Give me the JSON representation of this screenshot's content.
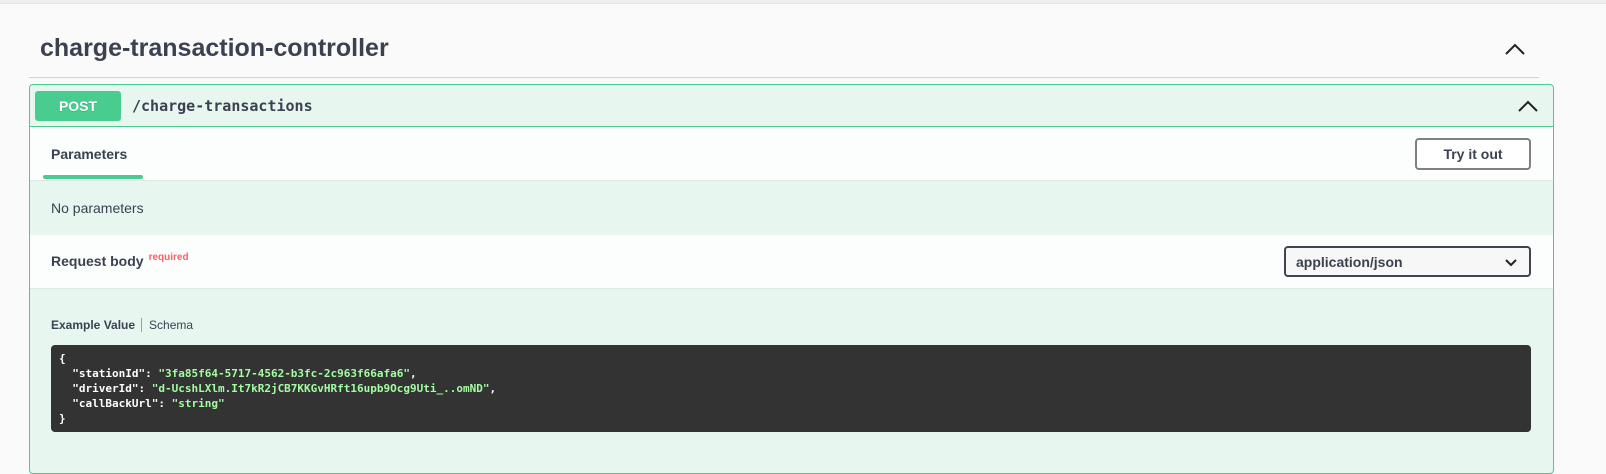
{
  "tag": {
    "title": "charge-transaction-controller",
    "toggle_icon": "chevron-up-icon"
  },
  "operation": {
    "method": "POST",
    "path": "/charge-transactions",
    "method_color": "#49cc90",
    "toggle_icon": "chevron-up-icon"
  },
  "parameters": {
    "tab_label": "Parameters",
    "try_button": "Try it out",
    "empty_text": "No parameters"
  },
  "request_body": {
    "title": "Request body",
    "required_label": "required",
    "content_type": "application/json"
  },
  "example": {
    "tab_example": "Example Value",
    "tab_schema": "Schema",
    "open_brace": "{",
    "close_brace": "}",
    "fields": [
      {
        "key": "\"stationId\"",
        "value": "\"3fa85f64-5717-4562-b3fc-2c963f66afa6\"",
        "trail": ","
      },
      {
        "key": "\"driverId\"",
        "value": "\"d-UcshLXlm.It7kR2jCB7KKGvHRft16upb9Ocg9Uti_..omND\"",
        "trail": ","
      },
      {
        "key": "\"callBackUrl\"",
        "value": "\"string\"",
        "trail": ""
      }
    ]
  }
}
